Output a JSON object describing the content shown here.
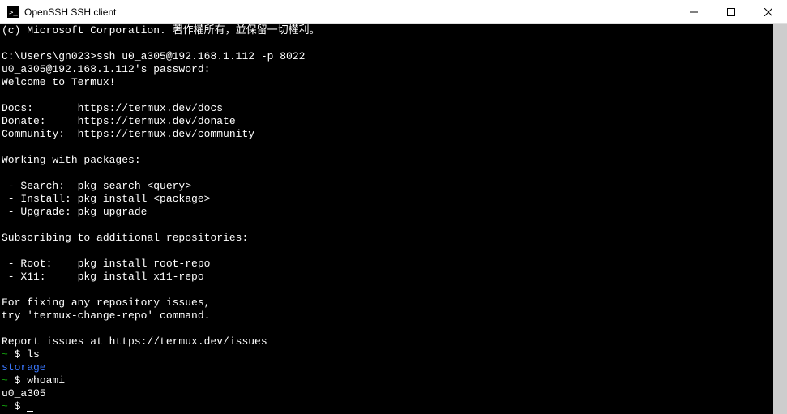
{
  "window": {
    "title": "OpenSSH SSH client"
  },
  "terminal": {
    "lines": [
      {
        "text": "(c) Microsoft Corporation. 著作權所有，並保留一切權利。"
      },
      {
        "text": ""
      },
      {
        "text": "C:\\Users\\gn023>ssh u0_a305@192.168.1.112 -p 8022"
      },
      {
        "text": "u0_a305@192.168.1.112's password:"
      },
      {
        "text": "Welcome to Termux!"
      },
      {
        "text": ""
      },
      {
        "text": "Docs:       https://termux.dev/docs"
      },
      {
        "text": "Donate:     https://termux.dev/donate"
      },
      {
        "text": "Community:  https://termux.dev/community"
      },
      {
        "text": ""
      },
      {
        "text": "Working with packages:"
      },
      {
        "text": ""
      },
      {
        "text": " - Search:  pkg search <query>"
      },
      {
        "text": " - Install: pkg install <package>"
      },
      {
        "text": " - Upgrade: pkg upgrade"
      },
      {
        "text": ""
      },
      {
        "text": "Subscribing to additional repositories:"
      },
      {
        "text": ""
      },
      {
        "text": " - Root:    pkg install root-repo"
      },
      {
        "text": " - X11:     pkg install x11-repo"
      },
      {
        "text": ""
      },
      {
        "text": "For fixing any repository issues,"
      },
      {
        "text": "try 'termux-change-repo' command."
      },
      {
        "text": ""
      },
      {
        "text": "Report issues at https://termux.dev/issues"
      }
    ],
    "prompt_tilde": "~",
    "prompt_dollar": " $ ",
    "cmd_ls": "ls",
    "output_storage": "storage",
    "cmd_whoami": "whoami",
    "output_user": "u0_a305"
  }
}
